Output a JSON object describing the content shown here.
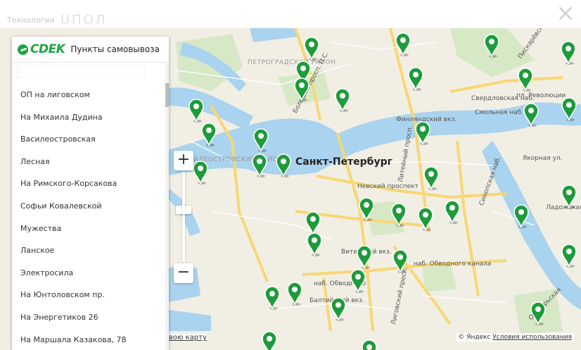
{
  "header": {
    "technologies_label": "Технологии",
    "brand_logo_text": "UПОЛ"
  },
  "panel": {
    "logo_text": "CDEK",
    "title": "Пункты самовывоза",
    "search_value": "",
    "items": [
      {
        "label": "ОП на лиговском"
      },
      {
        "label": "На Михаила Дудина"
      },
      {
        "label": "Василеостровская"
      },
      {
        "label": "Лесная"
      },
      {
        "label": "На Римского-Корсакова"
      },
      {
        "label": "Софьи Ковалевской"
      },
      {
        "label": "Мужества"
      },
      {
        "label": "Ланское"
      },
      {
        "label": "Электросила"
      },
      {
        "label": "На Юнтоловском пр."
      },
      {
        "label": "На Энергетиков 26"
      },
      {
        "label": "На Маршала Казакова, 78"
      }
    ]
  },
  "map": {
    "city_label": "Санкт-Петербург",
    "districts": [
      "ПЕТРОГРАДСКИЙ РАЙОН",
      "ВАСИЛЕОСТРОВСКИЙ РАЙОН"
    ],
    "streets": [
      "Большой просп. П.С.",
      "Финляндский вкз.",
      "Литейный просп.",
      "Невский проспект",
      "Витебский вкз.",
      "наб. Обводного канала",
      "наб. Обводного",
      "Балтийский вкз.",
      "Лиговский просп.",
      "Свердловская наб.",
      "Смольная наб.",
      "Якорная ул.",
      "Синопская наб.",
      "Ладожская",
      "Пискарёвский",
      "пл. Революции",
      "Октябрьская"
    ],
    "zoom_in_label": "+",
    "zoom_out_label": "−",
    "bottom_link": "вою карту",
    "copyright": "© Яндекс",
    "terms_link": "Условия использования",
    "accent_color": "#1fa342",
    "pin_color": "#1e9b3b"
  }
}
